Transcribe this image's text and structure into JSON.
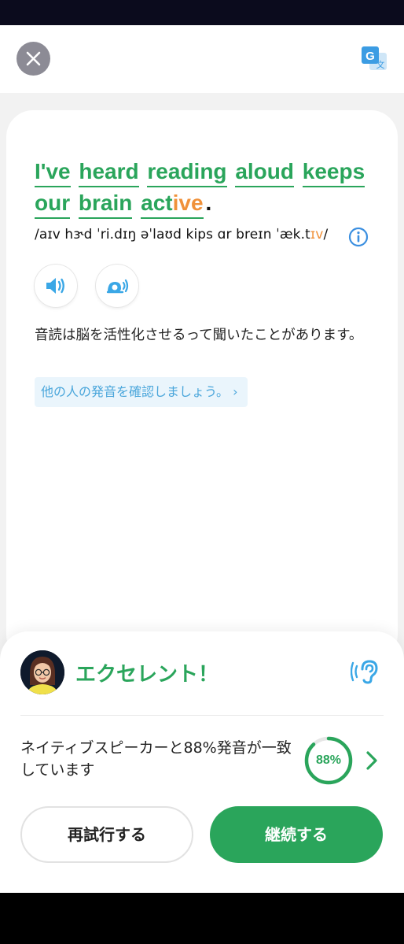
{
  "sentence": {
    "words": [
      "I've",
      "heard",
      "reading",
      "aloud",
      "keeps",
      "our",
      "brain"
    ],
    "last_word_prefix": "act",
    "last_word_highlight": "ive",
    "period": "."
  },
  "ipa": {
    "text_before": "/aɪv hɝd ˈri.dɪŋ əˈlaʊd kips ɑr breɪn ˈæk.t",
    "text_highlight": "ɪv",
    "text_after": "/"
  },
  "translation": "音読は脳を活性化させるって聞いたことがあります。",
  "others_link": "他の人の発音を確認しましょう。 ›",
  "result": {
    "title": "エクセレント！",
    "match_text": "ネイティブスピーカーと88%発音が一致しています",
    "score_label": "88%",
    "score": 0.88
  },
  "buttons": {
    "retry": "再試行する",
    "continue": "継続する"
  },
  "colors": {
    "accent_green": "#2aa55b",
    "highlight_orange": "#f0913a",
    "link_blue": "#4aa6db"
  },
  "icons": [
    "close-icon",
    "translate-icon",
    "info-icon",
    "speaker-icon",
    "snail-speaker-icon",
    "ear-icon",
    "chevron-right-icon"
  ]
}
